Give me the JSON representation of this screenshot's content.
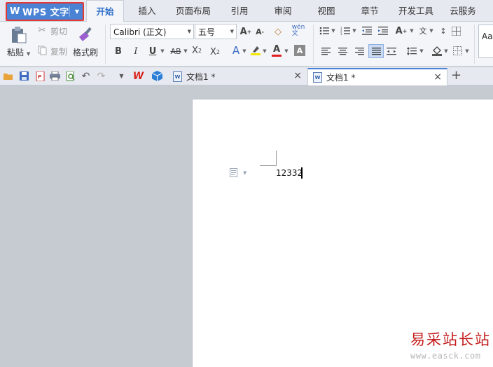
{
  "app": {
    "button_label": "WPS 文字",
    "logo_glyph": "W"
  },
  "menu": {
    "tabs": [
      {
        "label": "开始",
        "active": true
      },
      {
        "label": "插入"
      },
      {
        "label": "页面布局"
      },
      {
        "label": "引用"
      },
      {
        "label": "审阅"
      },
      {
        "label": "视图"
      },
      {
        "label": "章节"
      },
      {
        "label": "开发工具"
      },
      {
        "label": "云服务"
      }
    ]
  },
  "ribbon": {
    "paste_label": "粘贴",
    "cut_label": "剪切",
    "copy_label": "复制",
    "format_painter_label": "格式刷",
    "font_name": "Calibri (正文)",
    "font_size": "五号",
    "styles_preview": "Aa"
  },
  "documents": {
    "tabs": [
      {
        "title": "文档1 *",
        "active": false
      },
      {
        "title": "文档1 *",
        "active": true
      }
    ],
    "content_text": "12332"
  },
  "watermark": {
    "site_name": "易采站长站",
    "site_url": "www.easck.com"
  },
  "colors": {
    "accent": "#4a82d4",
    "highlight_border": "#e53935",
    "active_tab_text": "#2f6fc9",
    "watermark_red": "#c41d1d"
  }
}
